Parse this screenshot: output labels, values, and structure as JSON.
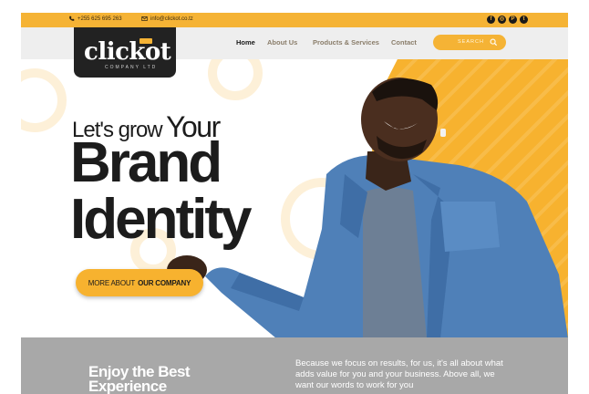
{
  "topbar": {
    "phone": "+255 625 695 263",
    "email": "info@clickot.co.tz",
    "social": [
      {
        "icon": "facebook-icon",
        "glyph": "f"
      },
      {
        "icon": "instagram-icon",
        "glyph": "◎"
      },
      {
        "icon": "pinterest-icon",
        "glyph": "P"
      },
      {
        "icon": "twitter-icon",
        "glyph": "t"
      }
    ]
  },
  "logo": {
    "wordmark": "clickot",
    "sub": "COMPANY LTD"
  },
  "nav": {
    "items": [
      {
        "label": "Home",
        "active": true
      },
      {
        "label": "About Us",
        "active": false
      },
      {
        "label": "Products & Services",
        "active": false
      },
      {
        "label": "Contact",
        "active": false
      }
    ],
    "search_placeholder": "SEARCH"
  },
  "hero": {
    "line1_a": "Let's grow",
    "line1_b": "Your",
    "line2": "Brand",
    "line3": "Identity",
    "cta_prefix": "MORE ABOUT",
    "cta_bold": "OUR COMPANY"
  },
  "band": {
    "heading": "Enjoy the Best Experience",
    "text": "Because we focus on results, for us, it's all about what adds value for you and your business. Above all, we want our words to work for you"
  },
  "colors": {
    "accent": "#f7b22f",
    "dark": "#1c1c1c",
    "band": "#a8a8a8"
  }
}
